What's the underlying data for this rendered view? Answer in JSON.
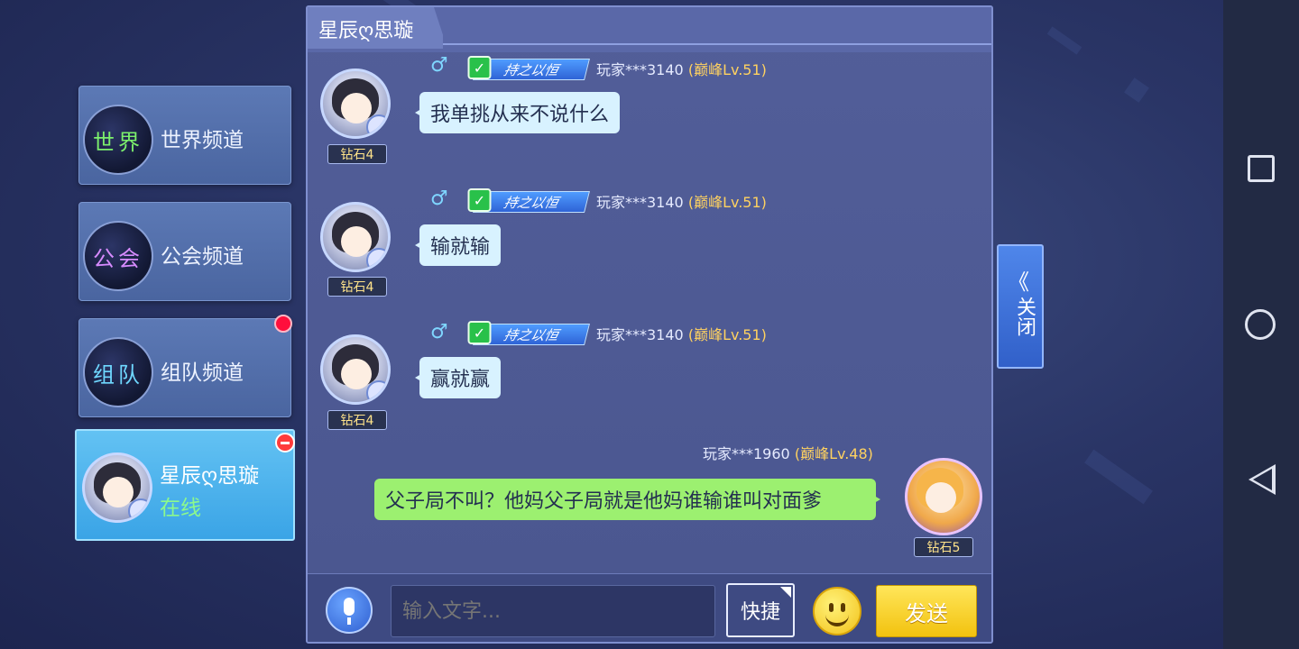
{
  "channels": [
    {
      "orb": "世界",
      "label": "世界频道"
    },
    {
      "orb": "公会",
      "label": "公会频道"
    },
    {
      "orb": "组队",
      "label": "组队频道"
    }
  ],
  "active_chat": {
    "name": "星辰ღ思璇",
    "status": "在线"
  },
  "panel": {
    "title": "星辰ღ思璇"
  },
  "messages": [
    {
      "gender": "♂",
      "title_badge": "持之以恒",
      "user": "玩家***3140",
      "level": "(巅峰Lv.51)",
      "rank": "钻石4",
      "text": "我单挑从来不说什么"
    },
    {
      "gender": "♂",
      "title_badge": "持之以恒",
      "user": "玩家***3140",
      "level": "(巅峰Lv.51)",
      "rank": "钻石4",
      "text": "输就输"
    },
    {
      "gender": "♂",
      "title_badge": "持之以恒",
      "user": "玩家***3140",
      "level": "(巅峰Lv.51)",
      "rank": "钻石4",
      "text": "赢就赢"
    },
    {
      "user": "玩家***1960",
      "level": "(巅峰Lv.48)",
      "rank": "钻石5",
      "text": "父子局不叫？他妈父子局就是他妈谁输谁叫对面爹"
    }
  ],
  "input": {
    "placeholder": "输入文字...",
    "quick_label": "快捷",
    "send_label": "发送"
  },
  "close_tab": {
    "chevron": "《",
    "label": "关闭"
  },
  "icons": {
    "mic": "microphone-icon",
    "emoji": "smiley-icon",
    "check": "checkmark-icon"
  },
  "colors": {
    "send": "#f2c20f",
    "level": "#ffd260",
    "online": "#8cf98c",
    "bubble_self": "#9cf070",
    "bubble_other": "#d8f2ff"
  }
}
